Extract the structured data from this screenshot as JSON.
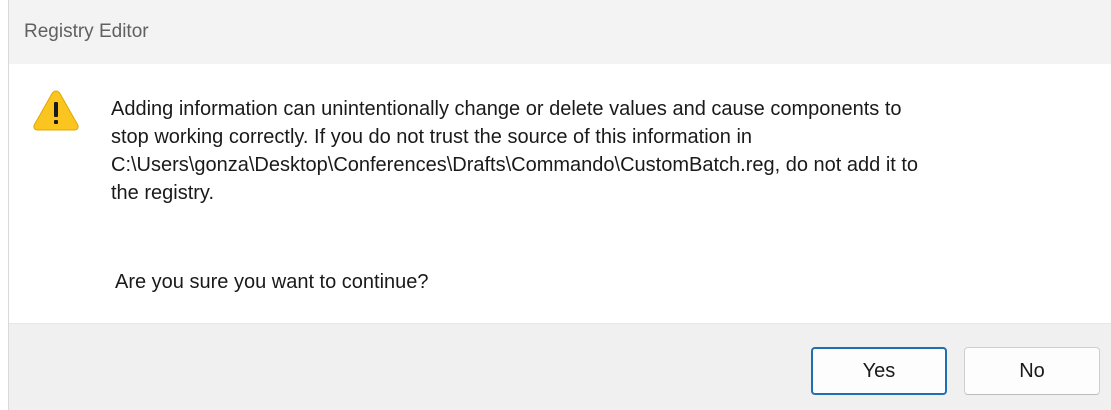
{
  "window": {
    "title": "Registry Editor"
  },
  "message": {
    "lines": [
      "Adding information can unintentionally change or delete values and cause components to",
      "stop working correctly. If you do not trust the source of this information in",
      "C:\\Users\\gonza\\Desktop\\Conferences\\Drafts\\Commando\\CustomBatch.reg, do not add it to",
      "the registry."
    ],
    "question": "Are you sure you want to continue?",
    "icon": "warning-icon"
  },
  "buttons": {
    "yes_label": "Yes",
    "no_label": "No"
  },
  "colors": {
    "warning_fill": "#f9c51e",
    "focus_border": "#1f6fb2"
  }
}
